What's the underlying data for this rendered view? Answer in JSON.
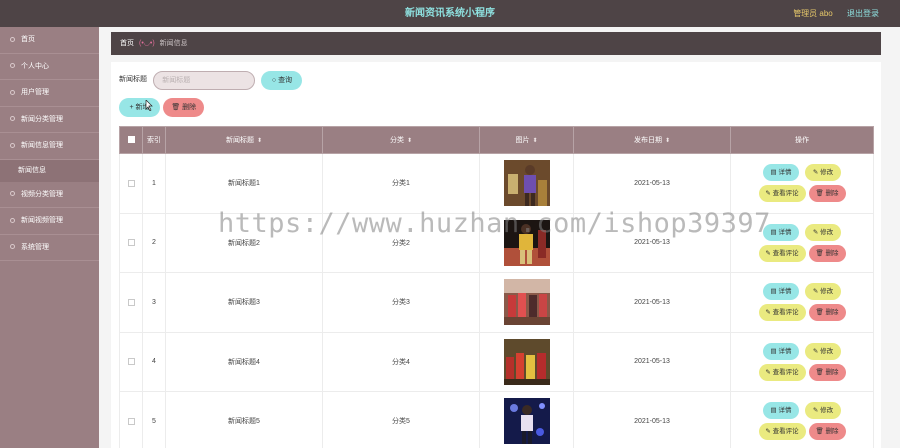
{
  "header": {
    "title": "新闻资讯系统小程序",
    "user": "管理员 abo",
    "logout": "退出登录"
  },
  "sidebar": {
    "items": [
      {
        "label": "首页"
      },
      {
        "label": "个人中心"
      },
      {
        "label": "用户管理"
      },
      {
        "label": "新闻分类管理"
      },
      {
        "label": "新闻信息管理"
      }
    ],
    "sub_item": "新闻信息",
    "items_after": [
      {
        "label": "视频分类管理"
      },
      {
        "label": "新闻视频管理"
      },
      {
        "label": "系统管理"
      }
    ]
  },
  "breadcrumb": {
    "home": "首页",
    "sep": "(•◡•)",
    "current": "新闻信息"
  },
  "search": {
    "label": "新闻标题",
    "placeholder": "新闻标题",
    "button": "查询"
  },
  "actions": {
    "add": "新增",
    "delete": "删除"
  },
  "table": {
    "columns": [
      "索引",
      "新闻标题",
      "分类",
      "图片",
      "发布日期",
      "操作"
    ],
    "sort_icon": "⬍",
    "rows": [
      {
        "index": "1",
        "title": "新闻标题1",
        "category": "分类1",
        "date": "2021-05-13"
      },
      {
        "index": "2",
        "title": "新闻标题2",
        "category": "分类2",
        "date": "2021-05-13"
      },
      {
        "index": "3",
        "title": "新闻标题3",
        "category": "分类3",
        "date": "2021-05-13"
      },
      {
        "index": "4",
        "title": "新闻标题4",
        "category": "分类4",
        "date": "2021-05-13"
      },
      {
        "index": "5",
        "title": "新闻标题5",
        "category": "分类5",
        "date": "2021-05-13"
      }
    ],
    "ops": {
      "detail": "详情",
      "edit": "修改",
      "comment": "查看评论",
      "delete": "删除"
    }
  },
  "watermark": "https://www.huzhan.com/ishop39397",
  "colors": {
    "topbar": "#4e4446",
    "sidebar": "#9a7f83",
    "accent_cyan": "#97e6e6",
    "accent_yellow": "#eaea80",
    "accent_red": "#ee8a8a"
  }
}
